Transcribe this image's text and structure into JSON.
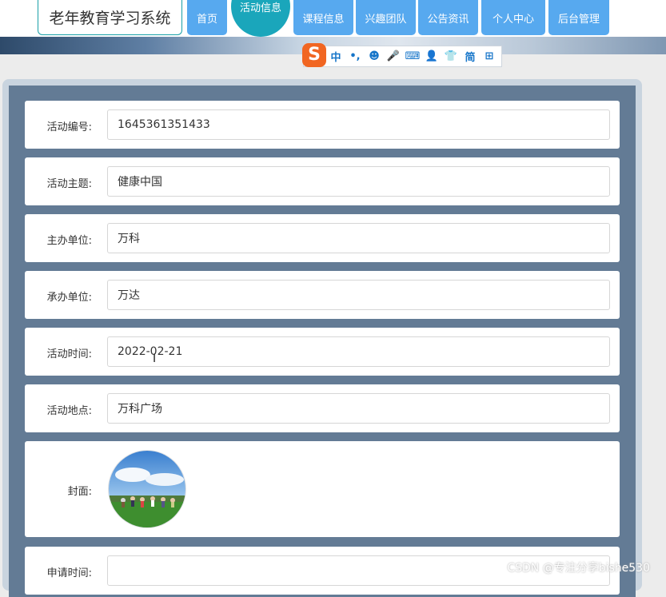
{
  "header": {
    "site_title": "老年教育学习系统",
    "nav": [
      {
        "label": "首页"
      },
      {
        "label": "活动信息",
        "active": true
      },
      {
        "label": "课程信息"
      },
      {
        "label": "兴趣团队"
      },
      {
        "label": "公告资讯"
      },
      {
        "label": "个人中心"
      },
      {
        "label": "后台管理"
      }
    ]
  },
  "ime_toolbar": {
    "logo": "S",
    "items": [
      "中",
      "•,",
      "☻",
      "🎤",
      "⌨",
      "👤",
      "👕",
      "简",
      "⊞"
    ]
  },
  "form": {
    "fields": [
      {
        "label": "活动编号:",
        "value": "1645361351433"
      },
      {
        "label": "活动主题:",
        "value": "健康中国"
      },
      {
        "label": "主办单位:",
        "value": "万科"
      },
      {
        "label": "承办单位:",
        "value": "万达"
      },
      {
        "label": "活动时间:",
        "value": "2022-02-21"
      },
      {
        "label": "活动地点:",
        "value": "万科广场"
      }
    ],
    "cover_label": "封面:",
    "apply_time_label": "申请时间:",
    "apply_time_value": ""
  },
  "watermark": "CSDN @专注分享bishe530",
  "colors": {
    "nav_blue": "#57a9ef",
    "nav_active": "#1aa6bb",
    "panel_dark": "#637b95"
  }
}
